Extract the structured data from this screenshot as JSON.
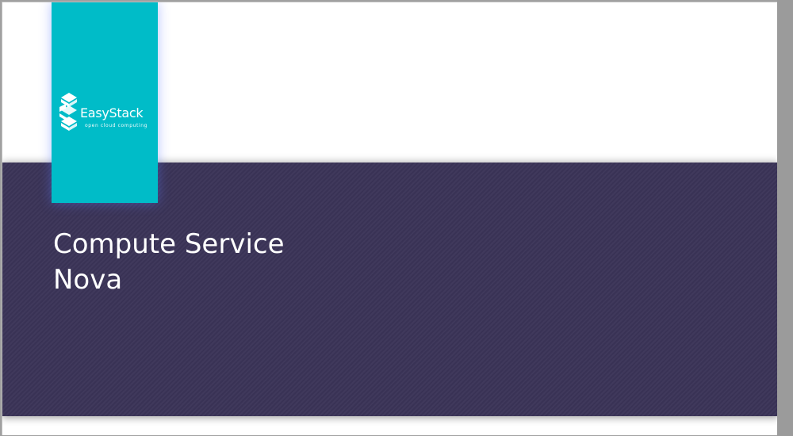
{
  "logo": {
    "brand": "EasyStack",
    "tagline": "open cloud computing",
    "icon": "easystack-logo-icon"
  },
  "title": {
    "line1": "Compute Service",
    "line2": "Nova"
  },
  "colors": {
    "band": "#3b3458",
    "logo_panel": "#00bcc8",
    "title_text": "#ffffff",
    "page_background": "#ffffff"
  }
}
